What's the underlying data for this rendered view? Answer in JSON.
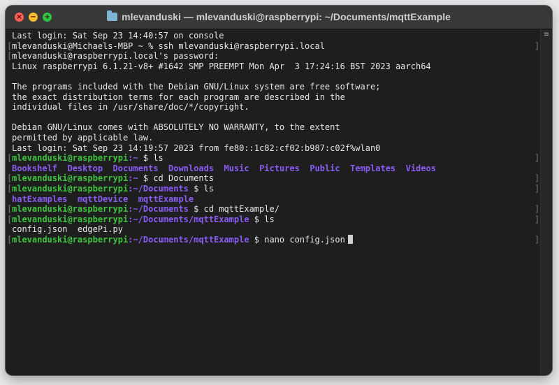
{
  "window": {
    "title": "mlevanduski — mlevanduski@raspberrypi: ~/Documents/mqttExample",
    "folder_icon": "folder-icon"
  },
  "colors": {
    "prompt_user": "#3cc43c",
    "prompt_path": "#8a5cf6",
    "text": "#e6e6e6",
    "background": "#1e1e1e"
  },
  "terminal": {
    "lines": {
      "l0": "Last login: Sat Sep 23 14:40:57 on console",
      "l1": "mlevanduski@Michaels-MBP ~ % ssh mlevanduski@raspberrypi.local",
      "l2": "mlevanduski@raspberrypi.local's password:",
      "l3": "Linux raspberrypi 6.1.21-v8+ #1642 SMP PREEMPT Mon Apr  3 17:24:16 BST 2023 aarch64",
      "l4": "",
      "l5": "The programs included with the Debian GNU/Linux system are free software;",
      "l6": "the exact distribution terms for each program are described in the",
      "l7": "individual files in /usr/share/doc/*/copyright.",
      "l8": "",
      "l9": "Debian GNU/Linux comes with ABSOLUTELY NO WARRANTY, to the extent",
      "l10": "permitted by applicable law.",
      "l11": "Last login: Sat Sep 23 14:19:57 2023 from fe80::1c82:cf02:b987:c02f%wlan0"
    },
    "prompt_user": "mlevanduski@raspberrypi",
    "prompts": {
      "p1": {
        "path": ":~",
        "cmd": " $ ls"
      },
      "p2": {
        "path": ":~",
        "cmd": " $ cd Documents"
      },
      "p3": {
        "path": ":~/Documents",
        "cmd": " $ ls"
      },
      "p4": {
        "path": ":~/Documents",
        "cmd": " $ cd mqttExample/"
      },
      "p5": {
        "path": ":~/Documents/mqttExample",
        "cmd": " $ ls"
      },
      "p6": {
        "path": ":~/Documents/mqttExample",
        "cmd": " $ nano config.json"
      }
    },
    "home_listing": [
      "Bookshelf",
      "Desktop",
      "Documents",
      "Downloads",
      "Music",
      "Pictures",
      "Public",
      "Templates",
      "Videos"
    ],
    "documents_listing": [
      "hatExamples",
      "mqttDevice",
      "mqttExample"
    ],
    "mqtt_listing": "config.json  edgePi.py"
  }
}
